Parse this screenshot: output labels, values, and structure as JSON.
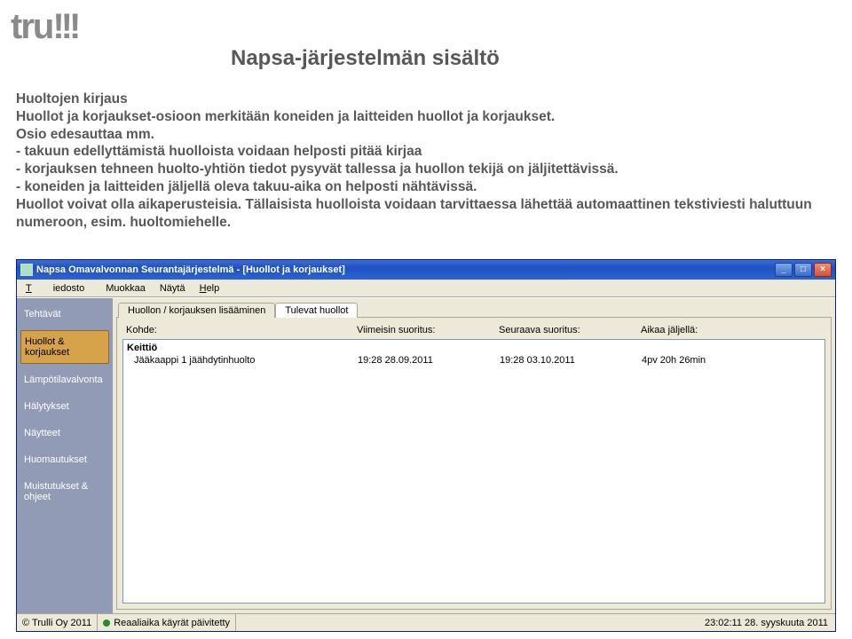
{
  "logo": {
    "text_a": "tru",
    "text_b": "!!!"
  },
  "title": "Napsa-järjestelmän sisältö",
  "body": {
    "l1": "Huoltojen kirjaus",
    "l2": "Huollot ja korjaukset-osioon merkitään koneiden ja laitteiden huollot ja korjaukset.",
    "l3": "Osio edesauttaa mm.",
    "l4": "- takuun edellyttämistä huolloista voidaan helposti pitää kirjaa",
    "l5": "- korjauksen tehneen huolto-yhtiön tiedot pysyvät tallessa ja huollon tekijä on jäljitettävissä.",
    "l6": "- koneiden ja laitteiden jäljellä oleva takuu-aika on helposti nähtävissä.",
    "l7": "Huollot voivat olla aikaperusteisia. Tällaisista huolloista voidaan tarvittaessa lähettää automaattinen tekstiviesti haluttuun numeroon, esim. huoltomiehelle."
  },
  "window": {
    "title": "Napsa Omavalvonnan Seurantajärjestelmä - [Huollot ja korjaukset]",
    "menu": {
      "tiedosto": "Tiedosto",
      "muokkaa": "Muokkaa",
      "nayta": "Näytä",
      "help": "Help"
    },
    "sidebar": {
      "items": [
        {
          "label": "Tehtävät",
          "active": false
        },
        {
          "label": "Huollot & korjaukset",
          "active": true
        },
        {
          "label": "Lämpötilavalvonta",
          "active": false
        },
        {
          "label": "Hälytykset",
          "active": false
        },
        {
          "label": "Näytteet",
          "active": false
        },
        {
          "label": "Huomautukset",
          "active": false
        },
        {
          "label": "Muistutukset & ohjeet",
          "active": false
        }
      ]
    },
    "tabs": {
      "t0": "Huollon / korjauksen lisääminen",
      "t1": "Tulevat huollot",
      "active": 1
    },
    "columns": {
      "kohde": "Kohde:",
      "viimeisin": "Viimeisin suoritus:",
      "seuraava": "Seuraava suoritus:",
      "aikaa": "Aikaa jäljellä:"
    },
    "rows": [
      {
        "kohde": "Keittiö",
        "viimeisin": "",
        "seuraava": "",
        "aikaa": "",
        "bold": true
      },
      {
        "kohde": "Jääkaappi 1 jäähdytinhuolto",
        "viimeisin": "19:28  28.09.2011",
        "seuraava": "19:28  03.10.2011",
        "aikaa": "4pv 20h 26min",
        "bold": false
      }
    ],
    "status": {
      "copyright": "© Trulli Oy 2011",
      "realtime_icon": "status-icon",
      "realtime": "Reaaliaika käyrät päivitetty",
      "clock": "23:02:11  28. syyskuuta 2011"
    },
    "winbuttons": {
      "min": "_",
      "max": "□",
      "close": "×"
    }
  }
}
